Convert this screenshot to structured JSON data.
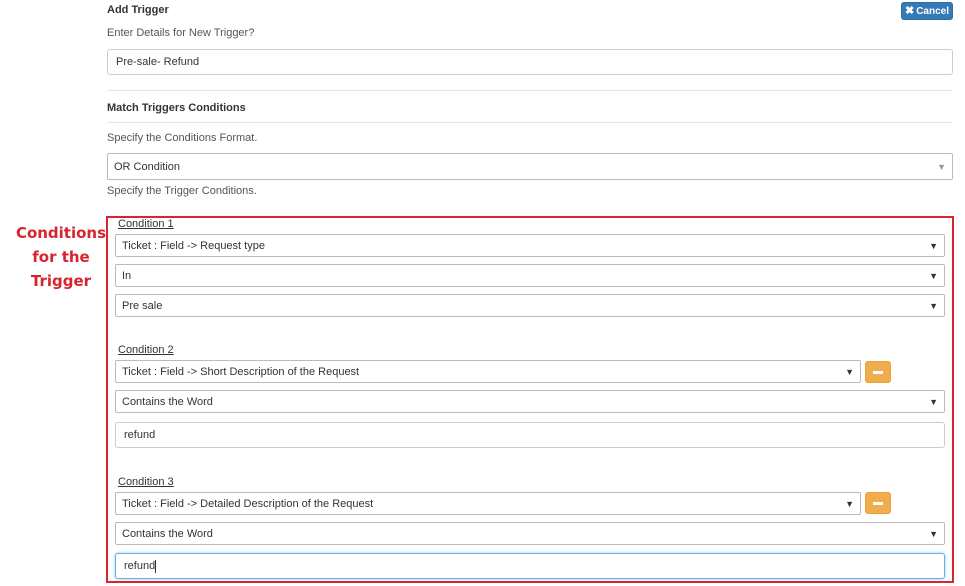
{
  "header": {
    "title": "Add Trigger",
    "cancel_label": "Cancel"
  },
  "details": {
    "prompt": "Enter Details for New Trigger?",
    "value": "Pre-sale- Refund"
  },
  "match": {
    "title": "Match Triggers Conditions",
    "format_prompt": "Specify the Conditions Format.",
    "format_value": "OR Condition",
    "conditions_prompt": "Specify the Trigger Conditions."
  },
  "annotation": {
    "line1": "Conditions",
    "line2": "for the",
    "line3": "Trigger"
  },
  "conditions": [
    {
      "label": "Condition 1",
      "field": "Ticket : Field -> Request type",
      "operator": "In",
      "value": "Pre sale"
    },
    {
      "label": "Condition 2",
      "field": "Ticket : Field -> Short Description of the Request",
      "operator": "Contains the Word",
      "value": "refund"
    },
    {
      "label": "Condition 3",
      "field": "Ticket : Field -> Detailed Description of the Request",
      "operator": "Contains the Word",
      "value": "refund"
    }
  ],
  "colors": {
    "annotation_red": "#d7242e",
    "cancel_blue": "#337ab7",
    "remove_orange": "#f0ad4e"
  }
}
